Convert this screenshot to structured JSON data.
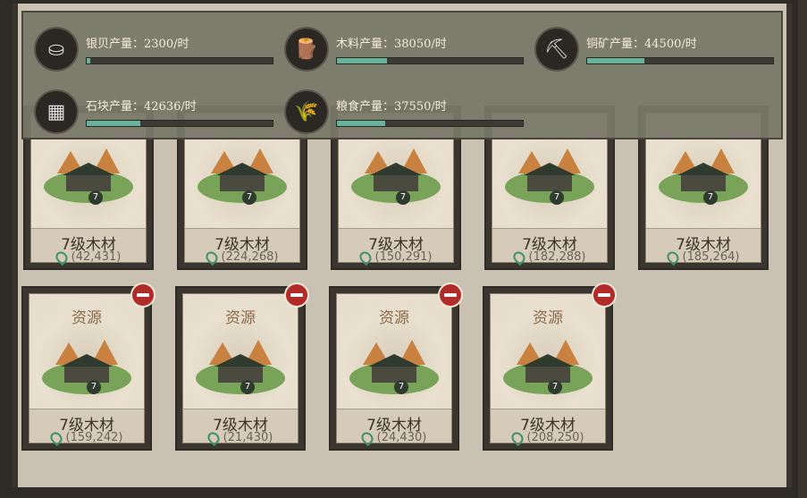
{
  "stats": [
    {
      "label": "银贝产量：2300/时",
      "icon": "silver-coin-icon",
      "progress": 0.02
    },
    {
      "label": "木料产量：38050/时",
      "icon": "wood-logs-icon",
      "progress": 0.27
    },
    {
      "label": "铜矿产量：44500/时",
      "icon": "copper-ore-icon",
      "progress": 0.31
    },
    {
      "label": "石块产量：42636/时",
      "icon": "stone-block-icon",
      "progress": 0.29
    },
    {
      "label": "粮食产量：37550/时",
      "icon": "grain-sack-icon",
      "progress": 0.26
    }
  ],
  "cards_top": [
    {
      "name": "7级木材",
      "level": "7",
      "coord": "(42,431)"
    },
    {
      "name": "7级木材",
      "level": "7",
      "coord": "(224,268)"
    },
    {
      "name": "7级木材",
      "level": "7",
      "coord": "(150,291)"
    },
    {
      "name": "7级木材",
      "level": "7",
      "coord": "(182,288)"
    },
    {
      "name": "7级木材",
      "level": "7",
      "coord": "(185,264)"
    }
  ],
  "cards_bottom": [
    {
      "type": "资源",
      "name": "7级木材",
      "level": "7",
      "coord": "(159,242)"
    },
    {
      "type": "资源",
      "name": "7级木材",
      "level": "7",
      "coord": "(21,430)"
    },
    {
      "type": "资源",
      "name": "7级木材",
      "level": "7",
      "coord": "(24,430)"
    },
    {
      "type": "资源",
      "name": "7级木材",
      "level": "7",
      "coord": "(208,250)"
    }
  ],
  "colors": {
    "progress_fill": "#67b39a",
    "remove_button": "#b22b2b"
  }
}
